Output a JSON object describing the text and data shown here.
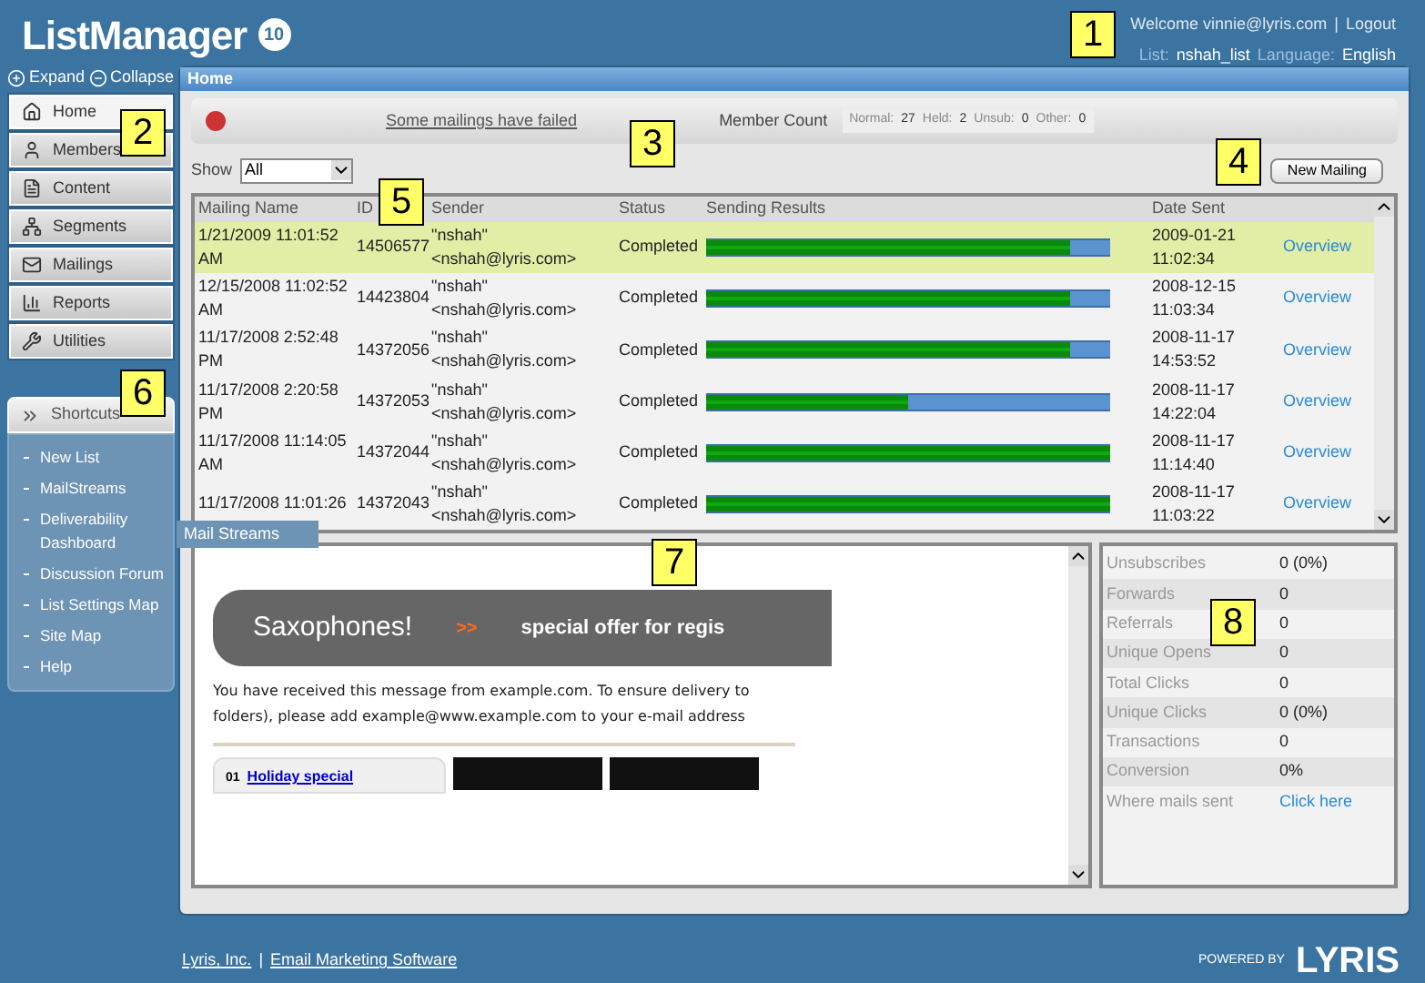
{
  "header": {
    "logo": "ListManager",
    "version": "10",
    "welcome": "Welcome vinnie@lyris.com",
    "logout": "Logout",
    "list_label": "List:",
    "list_value": "nshah_list",
    "language_label": "Language:",
    "language_value": "English"
  },
  "separator": "|",
  "sidebar": {
    "expand": "Expand",
    "collapse": "Collapse",
    "items": [
      {
        "label": "Home",
        "selected": true
      },
      {
        "label": "Members",
        "selected": false
      },
      {
        "label": "Content",
        "selected": false
      },
      {
        "label": "Segments",
        "selected": false
      },
      {
        "label": "Mailings",
        "selected": false
      },
      {
        "label": "Reports",
        "selected": false
      },
      {
        "label": "Utilities",
        "selected": false
      }
    ],
    "shortcuts_title": "Shortcuts",
    "shortcuts": [
      "New List",
      "MailStreams",
      "Deliverability Dashboard",
      "Discussion Forum",
      "List Settings Map",
      "Site Map",
      "Help"
    ],
    "flyout": "Mail Streams"
  },
  "page_title": "Home",
  "alert": {
    "text": "Some mailings have failed",
    "member_count_label": "Member Count",
    "counts": [
      {
        "label": "Normal:",
        "value": "27"
      },
      {
        "label": "Held:",
        "value": "2"
      },
      {
        "label": "Unsub:",
        "value": "0"
      },
      {
        "label": "Other:",
        "value": "0"
      }
    ]
  },
  "filter": {
    "label": "Show",
    "value": "All"
  },
  "new_mailing": "New Mailing",
  "table": {
    "columns": [
      "Mailing Name",
      "ID",
      "Sender",
      "Status",
      "Sending Results",
      "Date Sent"
    ],
    "rows": [
      {
        "name": "1/21/2009 11:01:52 AM",
        "id": "14506577",
        "sender_name": "\"nshah\"",
        "sender_email": "<nshah@lyris.com>",
        "status": "Completed",
        "level": 0.9,
        "date": "2009-01-21",
        "time": "11:02:34",
        "link": "Overview",
        "selected": true
      },
      {
        "name": "12/15/2008 11:02:52 AM",
        "id": "14423804",
        "sender_name": "\"nshah\"",
        "sender_email": "<nshah@lyris.com>",
        "status": "Completed",
        "level": 0.9,
        "date": "2008-12-15",
        "time": "11:03:34",
        "link": "Overview",
        "selected": false
      },
      {
        "name": "11/17/2008 2:52:48 PM",
        "id": "14372056",
        "sender_name": "\"nshah\"",
        "sender_email": "<nshah@lyris.com>",
        "status": "Completed",
        "level": 0.9,
        "date": "2008-11-17",
        "time": "14:53:52",
        "link": "Overview",
        "selected": false
      },
      {
        "name": "11/17/2008 2:20:58 PM",
        "id": "14372053",
        "sender_name": "\"nshah\"",
        "sender_email": "<nshah@lyris.com>",
        "status": "Completed",
        "level": 0.5,
        "date": "2008-11-17",
        "time": "14:22:04",
        "link": "Overview",
        "selected": false
      },
      {
        "name": "11/17/2008 11:14:05 AM",
        "id": "14372044",
        "sender_name": "\"nshah\"",
        "sender_email": "<nshah@lyris.com>",
        "status": "Completed",
        "level": 1,
        "date": "2008-11-17",
        "time": "11:14:40",
        "link": "Overview",
        "selected": false
      },
      {
        "name": "11/17/2008 11:01:26",
        "id": "14372043",
        "sender_name": "\"nshah\"",
        "sender_email": "<nshah@lyris.com>",
        "status": "Completed",
        "level": 1,
        "date": "2008-11-17",
        "time": "11:03:22",
        "link": "Overview",
        "selected": false
      }
    ]
  },
  "preview": {
    "banner_title": "Saxophones!",
    "banner_arrows": ">>",
    "banner_offer": "special offer for regis",
    "body_lines": [
      "You have received this message from example.com. To ensure delivery to",
      "folders), please add example@www.example.com to your e-mail address"
    ],
    "item_number": "01",
    "item_link": "Holiday special"
  },
  "stats": [
    {
      "label": "Unsubscribes",
      "value": "0 (0%)",
      "kind": "text"
    },
    {
      "label": "Forwards",
      "value": "0",
      "kind": "text"
    },
    {
      "label": "Referrals",
      "value": "0",
      "kind": "text"
    },
    {
      "label": "Unique Opens",
      "value": "0",
      "kind": "text"
    },
    {
      "label": "Total Clicks",
      "value": "0",
      "kind": "text"
    },
    {
      "label": "Unique Clicks",
      "value": "0 (0%)",
      "kind": "text"
    },
    {
      "label": "Transactions",
      "value": "0",
      "kind": "text"
    },
    {
      "label": "Conversion",
      "value": "0%",
      "kind": "text"
    },
    {
      "label": "Where mails sent",
      "value": "Click here",
      "kind": "link"
    }
  ],
  "callouts": [
    "1",
    "2",
    "3",
    "4",
    "5",
    "6",
    "7",
    "8"
  ],
  "footer": {
    "company": "Lyris, Inc.",
    "tagline": "Email Marketing Software",
    "powered_by": "POWERED BY",
    "brand": "LYRIS"
  }
}
